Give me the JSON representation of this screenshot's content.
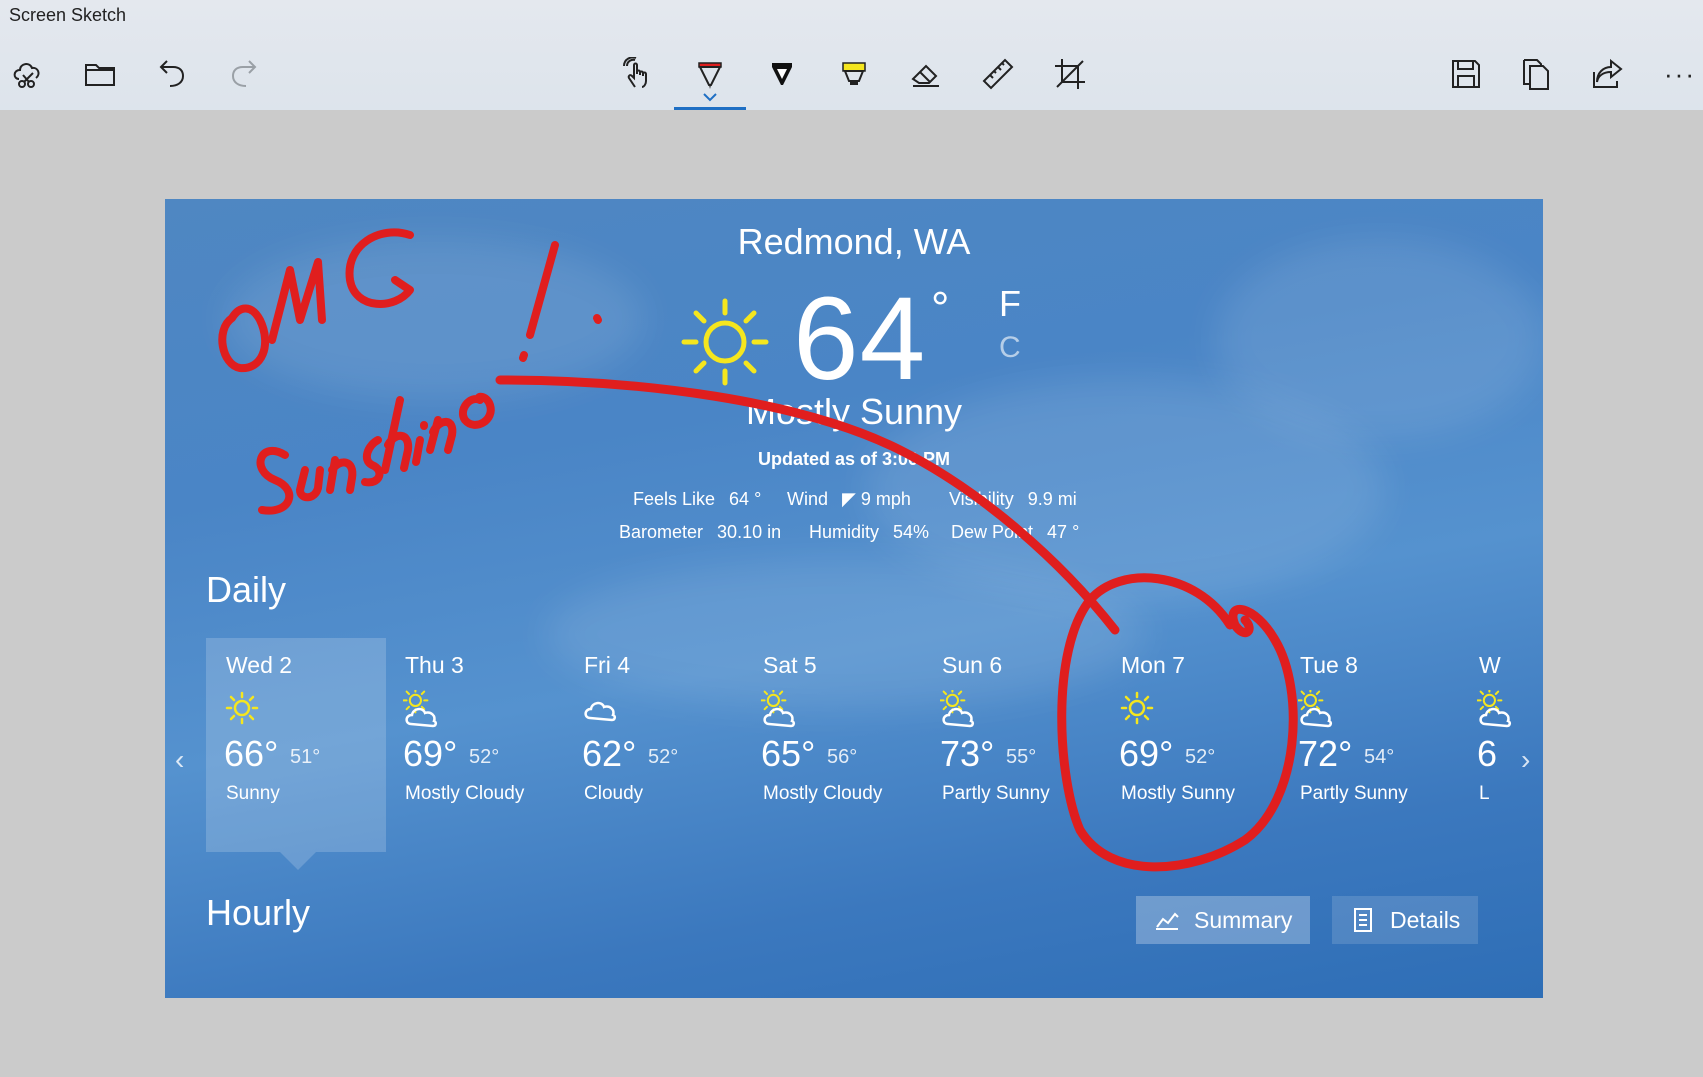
{
  "app": {
    "title": "Screen Sketch"
  },
  "toolbar": {
    "left": [
      "new-snip-icon",
      "open-folder-icon",
      "undo-icon",
      "redo-icon"
    ],
    "center": [
      "touch-writing-icon",
      "ballpoint-pen-icon",
      "pencil-icon",
      "highlighter-icon",
      "eraser-icon",
      "ruler-icon",
      "crop-icon"
    ],
    "right": [
      "save-icon",
      "copy-icon",
      "share-icon",
      "more-icon"
    ],
    "more_label": "···",
    "active_tool": "ballpoint-pen-icon",
    "pen_color": "#e01e1e",
    "highlighter_color": "#f5e61e"
  },
  "weather": {
    "city": "Redmond, WA",
    "temp": "64",
    "degree": "°",
    "unit_f": "F",
    "unit_c": "C",
    "condition": "Mostly Sunny",
    "updated": "Updated as of 3:00 PM",
    "stats": {
      "feels_like_label": "Feels Like",
      "feels_like": "64 °",
      "wind_label": "Wind",
      "wind": "◤ 9 mph",
      "visibility_label": "Visibility",
      "visibility": "9.9 mi",
      "barometer_label": "Barometer",
      "barometer": "30.10 in",
      "humidity_label": "Humidity",
      "humidity": "54%",
      "dew_point_label": "Dew Point",
      "dew_point": "47 °"
    },
    "daily_label": "Daily",
    "hourly_label": "Hourly",
    "days": [
      {
        "name": "Wed 2",
        "hi": "66°",
        "lo": "51°",
        "desc": "Sunny",
        "icon": "sun-icon"
      },
      {
        "name": "Thu 3",
        "hi": "69°",
        "lo": "52°",
        "desc": "Mostly Cloudy",
        "icon": "partly-cloudy-icon"
      },
      {
        "name": "Fri 4",
        "hi": "62°",
        "lo": "52°",
        "desc": "Cloudy",
        "icon": "cloud-icon"
      },
      {
        "name": "Sat 5",
        "hi": "65°",
        "lo": "56°",
        "desc": "Mostly Cloudy",
        "icon": "partly-cloudy-icon"
      },
      {
        "name": "Sun 6",
        "hi": "73°",
        "lo": "55°",
        "desc": "Partly Sunny",
        "icon": "partly-cloudy-icon"
      },
      {
        "name": "Mon 7",
        "hi": "69°",
        "lo": "52°",
        "desc": "Mostly Sunny",
        "icon": "sun-icon"
      },
      {
        "name": "Tue 8",
        "hi": "72°",
        "lo": "54°",
        "desc": "Partly Sunny",
        "icon": "partly-cloudy-icon"
      },
      {
        "name": "W",
        "hi": "6",
        "lo": "",
        "desc": "L",
        "icon": "partly-cloudy-icon"
      }
    ],
    "summary_label": "Summary",
    "details_label": "Details"
  },
  "annotation": {
    "text_line1": "OMG",
    "text_line2": "Sunshine!",
    "ink_color": "#e01e1e"
  }
}
